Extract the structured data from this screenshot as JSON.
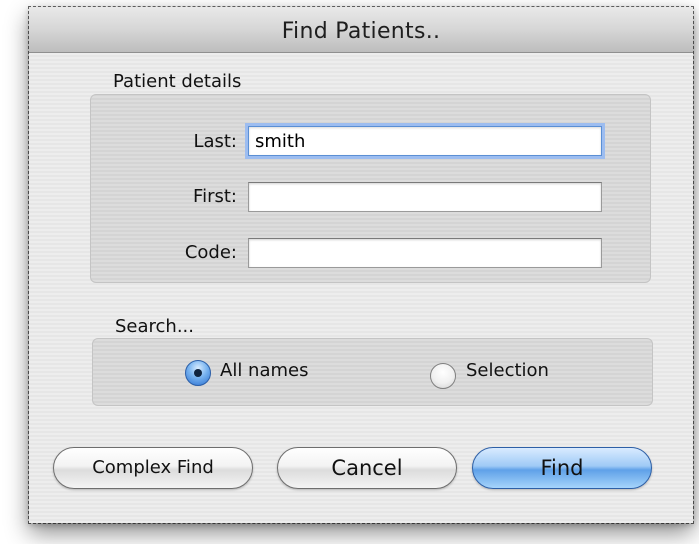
{
  "window": {
    "title": "Find Patients.."
  },
  "patient_details": {
    "label": "Patient details",
    "fields": [
      {
        "label": "Last:",
        "value": "smith",
        "focused": true
      },
      {
        "label": "First:",
        "value": ""
      },
      {
        "label": "Code:",
        "value": ""
      }
    ]
  },
  "search": {
    "label": "Search...",
    "options": [
      {
        "label": "All names",
        "selected": true
      },
      {
        "label": "Selection",
        "selected": false
      }
    ]
  },
  "buttons": {
    "complex_find": "Complex Find",
    "cancel": "Cancel",
    "find": "Find"
  },
  "colors": {
    "focus_ring": "#9dbdf0",
    "default_button": "#5fa1e8"
  }
}
